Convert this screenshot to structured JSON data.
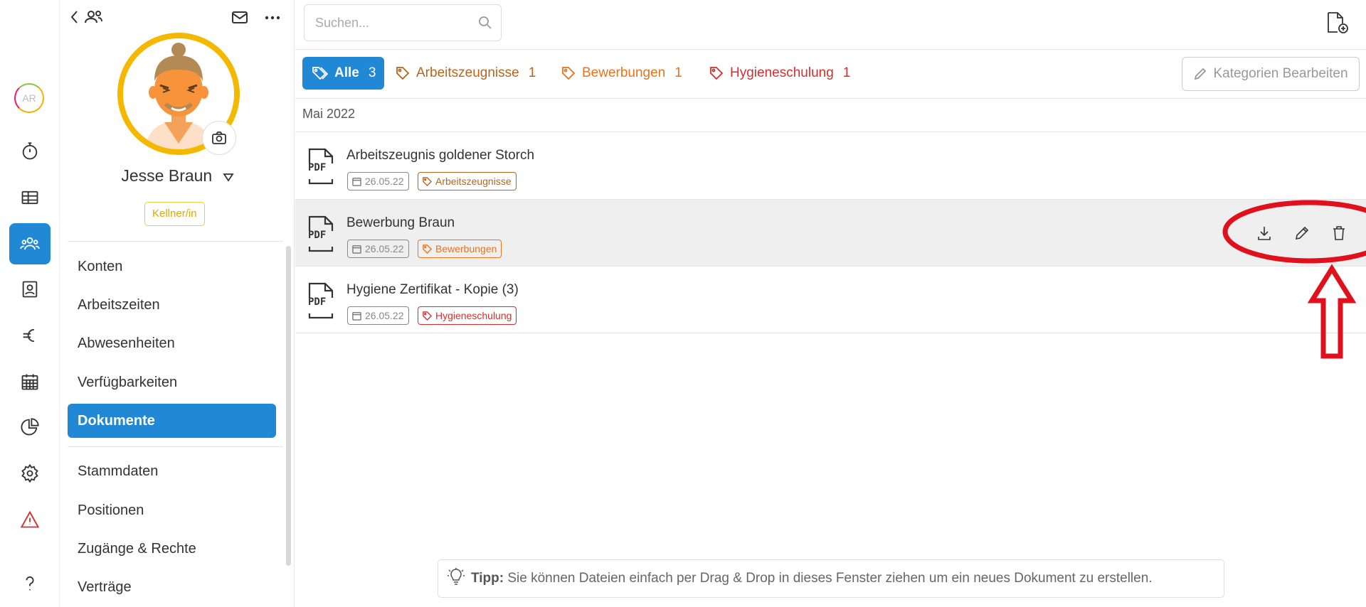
{
  "rail": {
    "avatar_initials": "AR",
    "items": [
      {
        "icon": "stopwatch-icon"
      },
      {
        "icon": "table-icon"
      },
      {
        "icon": "users-icon",
        "active": true
      },
      {
        "icon": "contact-card-icon"
      },
      {
        "icon": "euro-icon"
      },
      {
        "icon": "calendar-icon"
      },
      {
        "icon": "pie-chart-icon"
      },
      {
        "icon": "gear-icon"
      },
      {
        "icon": "warning-icon"
      },
      {
        "icon": "help-icon"
      }
    ]
  },
  "profile": {
    "name": "Jesse Braun",
    "role": "Kellner/in"
  },
  "menu": {
    "items": [
      "Konten",
      "Arbeitszeiten",
      "Abwesenheiten",
      "Verfügbarkeiten",
      "Dokumente",
      "Stammdaten",
      "Positionen",
      "Zugänge & Rechte",
      "Verträge"
    ],
    "active": "Dokumente"
  },
  "search": {
    "placeholder": "Suchen..."
  },
  "tabs": [
    {
      "label": "Alle",
      "count": "3",
      "color": "#2088d4",
      "active": true
    },
    {
      "label": "Arbeitszeugnisse",
      "count": "1",
      "color": "#b5651d"
    },
    {
      "label": "Bewerbungen",
      "count": "1",
      "color": "#e8731c"
    },
    {
      "label": "Hygieneschulung",
      "count": "1",
      "color": "#d32f2f"
    }
  ],
  "edit_categories_label": "Kategorien Bearbeiten",
  "month_header": "Mai 2022",
  "documents": [
    {
      "title": "Arbeitszeugnis goldener Storch",
      "date": "26.05.22",
      "category": "Arbeitszeugnisse",
      "category_color": "#b5651d"
    },
    {
      "title": "Bewerbung Braun",
      "date": "26.05.22",
      "category": "Bewerbungen",
      "category_color": "#e8731c"
    },
    {
      "title": "Hygiene Zertifikat - Kopie (3)",
      "date": "26.05.22",
      "category": "Hygieneschulung",
      "category_color": "#d32f2f"
    }
  ],
  "tip": {
    "label": "Tipp:",
    "text": "Sie können Dateien einfach per Drag & Drop in dieses Fenster ziehen um ein neues Dokument zu erstellen."
  },
  "pdf_label": "PDF"
}
